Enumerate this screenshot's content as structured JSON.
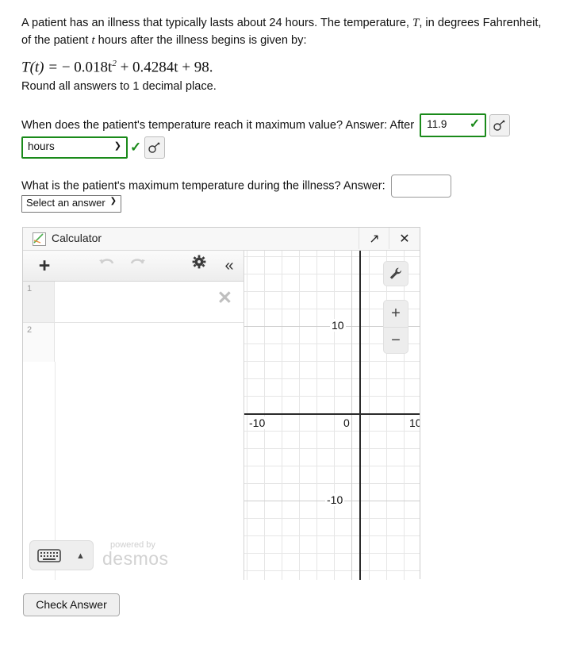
{
  "problem": {
    "line1_a": "A patient has an illness that typically lasts about 24 hours. The temperature, ",
    "line1_var": "T",
    "line1_b": ", in degrees Fahrenheit, of the patient ",
    "line1_var2": "t",
    "line1_c": " hours after the illness begins is given by:",
    "formula_lhs": "T(t) = ",
    "formula_rhs": "− 0.018t",
    "formula_exp": "2",
    "formula_rhs2": " + 0.4284t + 98.",
    "rounding_note": "Round all answers to 1 decimal place."
  },
  "question1": {
    "text": "When does the patient's temperature reach it maximum value?  Answer: After",
    "answer_value": "11.9",
    "status_icon": "check-icon",
    "key_icon": "key-icon",
    "unit_select_value": "hours",
    "unit_caret": "⌄",
    "correct_color": "#1a8a1a"
  },
  "question2": {
    "text": "What is the patient's maximum temperature during the illness?  Answer:",
    "answer_value": "",
    "select_value": "Select an answer",
    "select_caret": "⌄"
  },
  "calculator": {
    "title": "Calculator",
    "logo_icon": "desmos-graph-icon",
    "expand_icon": "↗",
    "close_icon": "✕",
    "toolbar": {
      "add_icon": "+",
      "undo_icon": "undo-arrow-icon",
      "redo_icon": "redo-arrow-icon",
      "settings_icon": "gear-icon",
      "collapse_icon": "«"
    },
    "expressions": [
      {
        "number": "1",
        "value": "",
        "delete_icon": "✕"
      },
      {
        "number": "2",
        "value": ""
      }
    ],
    "keyboard_button": {
      "icon": "keyboard-icon",
      "caret": "▲"
    },
    "branding_top": "powered by",
    "branding_name": "desmos",
    "graph": {
      "wrench_icon": "ὒ7",
      "zoom_in": "+",
      "zoom_out": "−",
      "x_labels": [
        "-10",
        "0",
        "10"
      ],
      "y_labels": [
        "10",
        "-10"
      ],
      "grid": true
    }
  },
  "footer": {
    "check_answer_label": "Check Answer"
  }
}
